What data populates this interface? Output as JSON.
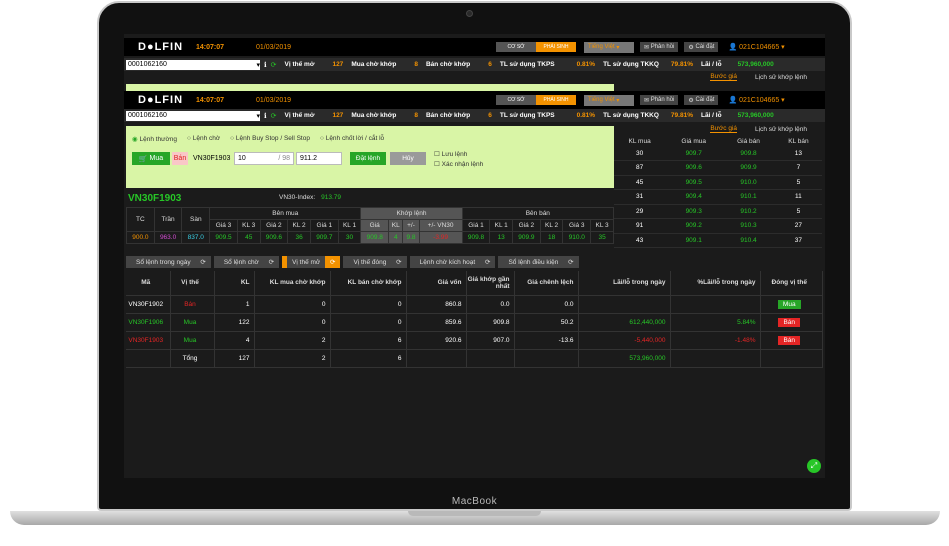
{
  "device": {
    "label": "MacBook"
  },
  "header": {
    "logo": "D●LFIN",
    "time": "14:07:07",
    "date": "01/03/2019",
    "seg_coso": "CƠ SỞ",
    "seg_phaisinh": "PHÁI SINH",
    "language": "Tiếng Việt",
    "feedback": "Phản hồi",
    "settings": "Cài đặt",
    "account_code": "021C104665"
  },
  "header2": {
    "account_code": "021C104665"
  },
  "infobar": {
    "account": "0001062160",
    "vithe_mo_label": "Vị thế mở",
    "vithe_mo": "127",
    "mua_cho_khop_label": "Mua chờ khớp",
    "mua_cho_khop": "8",
    "ban_cho_khop_label": "Bán chờ khớp",
    "ban_cho_khop": "6",
    "tkps_label": "TL sử dụng TKPS",
    "tkps": "0.81%",
    "tkkq_label": "TL sử dụng TKKQ",
    "tkkq": "79.81%",
    "lailo_label": "Lãi / lỗ",
    "lailo": "573,960,000"
  },
  "subtabs": {
    "buoc_gia": "Bước giá",
    "lich_su": "Lịch sử khớp lệnh"
  },
  "order": {
    "types": [
      "Lệnh thường",
      "Lệnh chờ",
      "Lệnh Buy Stop / Sell Stop",
      "Lệnh chốt lời / cắt lỗ"
    ],
    "buy": "Mua",
    "sell": "Bán",
    "symbol": "VN30F1903",
    "quantity": "10",
    "quantity_max": "/ 98",
    "price": "911.2",
    "place": "Đặt lệnh",
    "cancel": "Hủy",
    "save_label": "Lưu lệnh",
    "confirm_label": "Xác nhận lệnh"
  },
  "quote": {
    "symbol": "VN30F1903",
    "index_label": "VN30-Index:",
    "index_value": "913.79",
    "headers": {
      "tc": "TC",
      "tran": "Trần",
      "san": "Sàn",
      "ben_mua": "Bên mua",
      "khop": "Khớp lệnh",
      "ben_ban": "Bên bán",
      "g3": "Giá 3",
      "kl3": "KL 3",
      "g2": "Giá 2",
      "kl2": "KL 2",
      "g1": "Giá 1",
      "kl1": "KL 1",
      "gia": "Giá",
      "kl": "KL",
      "pm": "+/-",
      "pmvn30": "+/- VN30"
    },
    "row": {
      "tc": "900.0",
      "tran": "963.0",
      "san": "837.0",
      "bg3": "909.5",
      "bkl3": "45",
      "bg2": "909.6",
      "bkl2": "36",
      "bg1": "909.7",
      "bkl1": "30",
      "kgia": "909.8",
      "kkl": "4",
      "kpm": "9.8",
      "kvn30": "-3.99",
      "sg1": "909.8",
      "skl1": "13",
      "sg2": "909.9",
      "skl2": "18",
      "sg3": "910.0",
      "skl3": "35"
    }
  },
  "depth": {
    "headers": {
      "kl_mua": "KL mua",
      "gia_mua": "Giá mua",
      "gia_ban": "Giá bán",
      "kl_ban": "KL bán"
    },
    "rows": [
      {
        "kl_mua": "30",
        "gia_mua": "909.7",
        "gia_ban": "909.8",
        "kl_ban": "13",
        "bar": 0.2
      },
      {
        "kl_mua": "87",
        "gia_mua": "909.6",
        "gia_ban": "909.9",
        "kl_ban": "7",
        "bar": 0.4
      },
      {
        "kl_mua": "45",
        "gia_mua": "909.5",
        "gia_ban": "910.0",
        "kl_ban": "5",
        "bar": 0.3
      },
      {
        "kl_mua": "31",
        "gia_mua": "909.4",
        "gia_ban": "910.1",
        "kl_ban": "11",
        "bar": 0.25
      },
      {
        "kl_mua": "29",
        "gia_mua": "909.3",
        "gia_ban": "910.2",
        "kl_ban": "5",
        "bar": 0.2
      },
      {
        "kl_mua": "91",
        "gia_mua": "909.2",
        "gia_ban": "910.3",
        "kl_ban": "27",
        "bar": 0.65
      },
      {
        "kl_mua": "43",
        "gia_mua": "909.1",
        "gia_ban": "910.4",
        "kl_ban": "37",
        "bar": 0.45
      }
    ]
  },
  "tabs": [
    "Sổ lệnh trong ngày",
    "Sổ lệnh chờ",
    "Vị thế mở",
    "Vị thế đóng",
    "Lệnh chờ kích hoạt",
    "Sổ lệnh điều kiện"
  ],
  "positions": {
    "headers": {
      "ma": "Mã",
      "vithe": "Vị thế",
      "kl": "KL",
      "kl_mua": "KL mua chờ khớp",
      "kl_ban": "KL bán chờ khớp",
      "gia_von": "Giá vốn",
      "gia_khop": "Giá khớp gần nhất",
      "chenh": "Giá chênh lệch",
      "lailo": "Lãi/lỗ trong ngày",
      "pct": "%Lãi/lỗ trong ngày",
      "dong": "Đóng vị thế"
    },
    "rows": [
      {
        "ma": "VN30F1902",
        "vithe": "Bán",
        "kl": "1",
        "kl_mua": "0",
        "kl_ban": "0",
        "gia_von": "860.8",
        "gia_khop": "0.0",
        "chenh": "0.0",
        "lailo": "",
        "pct": "",
        "dong": "Mua"
      },
      {
        "ma": "VN30F1906",
        "vithe": "Mua",
        "kl": "122",
        "kl_mua": "0",
        "kl_ban": "0",
        "gia_von": "859.6",
        "gia_khop": "909.8",
        "chenh": "50.2",
        "lailo": "612,440,000",
        "pct": "5.84%",
        "dong": "Bán"
      },
      {
        "ma": "VN30F1903",
        "vithe": "Mua",
        "kl": "4",
        "kl_mua": "2",
        "kl_ban": "6",
        "gia_von": "920.6",
        "gia_khop": "907.0",
        "chenh": "-13.6",
        "lailo": "-5,440,000",
        "pct": "-1.48%",
        "dong": "Bán"
      }
    ],
    "total_label": "Tổng",
    "total_kl": "127",
    "total_kl_mua": "2",
    "total_kl_ban": "6",
    "total_lailo": "573,960,000"
  },
  "colors": {
    "accent": "#f39200",
    "up": "#27c627",
    "down": "#e42525",
    "panel": "#d9f5a6"
  }
}
